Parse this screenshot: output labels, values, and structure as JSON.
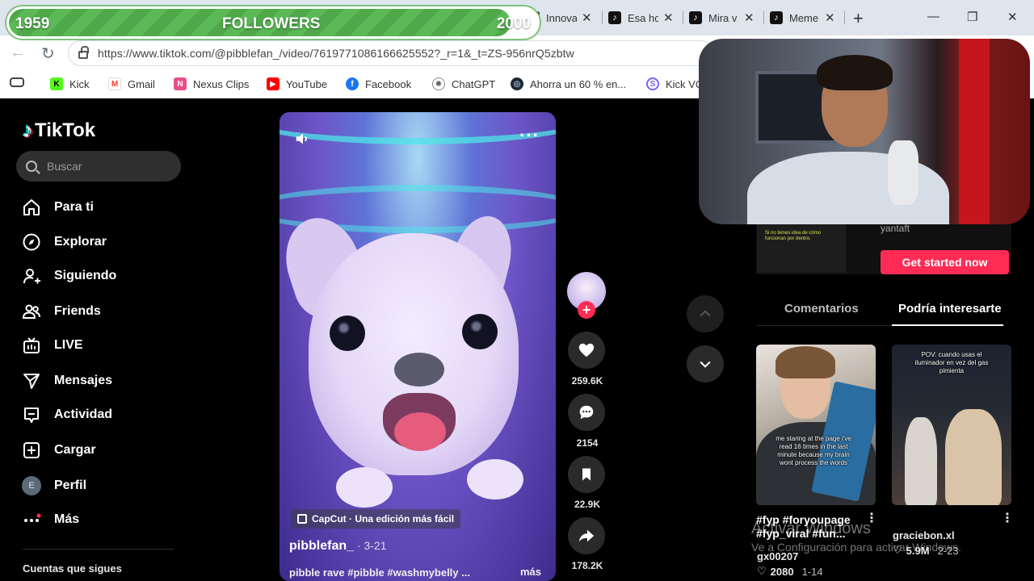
{
  "overlay": {
    "followers_start": "1959",
    "followers_label": "FOLLOWERS",
    "followers_goal": "2000",
    "followers_progress": 0.95,
    "bar_color": "#4fa94b"
  },
  "browser": {
    "tabs": [
      {
        "label": "Innova",
        "icon": "page-icon"
      },
      {
        "label": "Esa ho",
        "icon": "tiktok-icon"
      },
      {
        "label": "Mira v",
        "icon": "tiktok-icon"
      },
      {
        "label": "Meme",
        "icon": "tiktok-icon"
      }
    ],
    "url": "https://www.tiktok.com/@pibblefan_/video/7619771086166625552?_r=1&_t=ZS-956nrQ5zbtw",
    "bookmarks": [
      {
        "label": "Kick",
        "color": "#53fc18"
      },
      {
        "label": "Gmail",
        "color": "#ea4335"
      },
      {
        "label": "Nexus Clips",
        "color": "#e84f8a"
      },
      {
        "label": "YouTube",
        "color": "#ff0000"
      },
      {
        "label": "Facebook",
        "color": "#1877f2"
      },
      {
        "label": "ChatGPT",
        "color": "#555555"
      },
      {
        "label": "Ahorra un 60 % en...",
        "color": "#1b2838"
      },
      {
        "label": "Kick VO",
        "color": "#7b61ff"
      }
    ]
  },
  "tiktok": {
    "logo": "TikTok",
    "search_placeholder": "Buscar",
    "nav": [
      {
        "label": "Para ti",
        "icon": "home-icon"
      },
      {
        "label": "Explorar",
        "icon": "compass-icon"
      },
      {
        "label": "Siguiendo",
        "icon": "user-follow-icon"
      },
      {
        "label": "Friends",
        "icon": "friends-icon"
      },
      {
        "label": "LIVE",
        "icon": "live-tv-icon"
      },
      {
        "label": "Mensajes",
        "icon": "send-icon"
      },
      {
        "label": "Actividad",
        "icon": "activity-icon"
      },
      {
        "label": "Cargar",
        "icon": "upload-icon"
      },
      {
        "label": "Perfil",
        "icon": "avatar",
        "avatar_letter": "E"
      },
      {
        "label": "Más",
        "icon": "more-icon"
      }
    ],
    "following_title": "Cuentas que sigues",
    "accent": "#fe2c55"
  },
  "video": {
    "capcut_label": "CapCut · Una edición más fácil",
    "author": "pibblefan_",
    "date": " · 3-21",
    "caption": "pibble rave #pibble #washmybelly ...",
    "more": "más"
  },
  "actions": {
    "likes": "259.6K",
    "comments": "2154",
    "saves": "22.9K",
    "shares": "178.2K"
  },
  "right_panel": {
    "ad_brand": "yantaft",
    "ad_thumb_text": "Si no tienes idea de cómo funcionan por dentro.",
    "ad_button": "Get started now",
    "tabs": [
      "Comentarios",
      "Podría interesarte"
    ],
    "recommendations": [
      {
        "overlay_text": "me staring at the page i've read 16 times in the last minute because my brain wont process the words",
        "title": "#fyp #foryoupage #fyp_viral #fun...",
        "user": "gx00207",
        "likes": "2080",
        "date": "1-14"
      },
      {
        "overlay_text": "POV: cuando usas el iluminador en vez del gas pimienta",
        "title": "",
        "user": "graciebon.xl",
        "likes": "5.9M",
        "date": "2-23"
      }
    ],
    "windows_activate": "Activar Windows",
    "windows_activate_sub": "Ve a Configuración para activar Windows."
  }
}
